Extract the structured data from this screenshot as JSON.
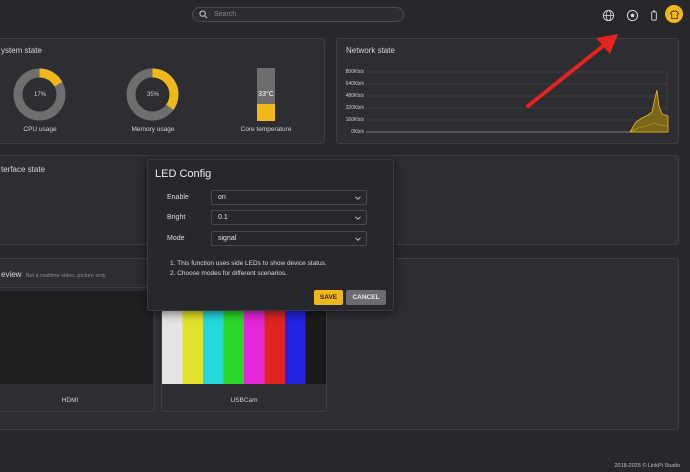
{
  "search": {
    "placeholder": "Search"
  },
  "topbar_icons": [
    "globe-icon",
    "soccer-ball-icon",
    "battery-icon",
    "avatar-icon"
  ],
  "system_state": {
    "title": "ystem state",
    "cpu": {
      "value": 17,
      "text": "17%",
      "label": "CPU usage"
    },
    "memory": {
      "value": 35,
      "text": "35%",
      "label": "Memory usage"
    },
    "temperature": {
      "value": 33,
      "text": "33°C",
      "label": "Core temperature"
    }
  },
  "network_state": {
    "title": "Network state",
    "y_labels": [
      "800Kb/s",
      "640Kb/s",
      "480Kb/s",
      "320Kb/s",
      "160Kb/s",
      "0Kb/s"
    ]
  },
  "interface_state": {
    "title": "terface state"
  },
  "preview": {
    "title": "eview",
    "subtitle": "Not a realtime video, picture only",
    "tiles": [
      {
        "label": "HDMI"
      },
      {
        "label": "USBCam"
      }
    ]
  },
  "led_config": {
    "title": "LED Config",
    "fields": [
      {
        "label": "Enable",
        "value": "on"
      },
      {
        "label": "Bright",
        "value": "0.1"
      },
      {
        "label": "Mode",
        "value": "signal"
      }
    ],
    "notes": [
      "1. This function uses side LEDs to show device status.",
      "2. Choose modes for different scenarios."
    ],
    "save_label": "SAVE",
    "cancel_label": "CANCEL"
  },
  "colors": {
    "accent": "#f0b81a",
    "arrow": "#e8221e"
  },
  "footer": {
    "text": "2018-2025 © LinkPi Studio"
  }
}
